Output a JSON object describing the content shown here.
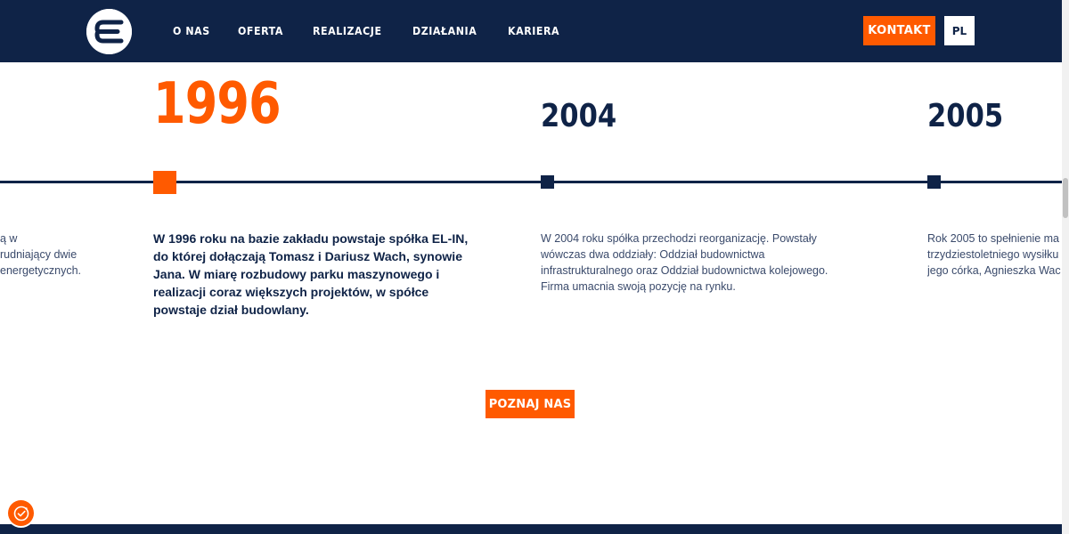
{
  "header": {
    "logo_icon": "el-in-logo-icon",
    "nav": [
      "O NAS",
      "OFERTA",
      "REALIZACJE",
      "DZIAŁANIA",
      "KARIERA"
    ],
    "contact_label": "KONTAKT",
    "lang_label": "PL"
  },
  "timeline": {
    "prev_text": "ą w\nrudniający dwie\nenergetycznych.",
    "events": [
      {
        "year": "1996",
        "text": "W 1996 roku na bazie zakładu powstaje spółka EL-IN, do której dołączają Tomasz i Dariusz Wach, synowie Jana. W miarę rozbudowy parku maszynowego i realizacji coraz większych projektów, w spółce powstaje dział budowlany."
      },
      {
        "year": "2004",
        "text": "W 2004 roku spółka przechodzi reorganizację. Powstały wówczas dwa oddziały: Oddział budownictwa infrastrukturalnego oraz Oddział budownictwa kolejowego. Firma umacnia swoją pozycję na rynku."
      },
      {
        "year": "2005",
        "text": "Rok 2005 to spełnienie ma\ntrzydziestoletniego wysiłku\njego córka, Agnieszka Wac"
      }
    ],
    "cta_label": "POZNAJ NAS"
  },
  "colors": {
    "navy": "#0f2347",
    "orange": "#ff5a00",
    "white": "#ffffff"
  },
  "cookie_icon": "cookie-icon"
}
